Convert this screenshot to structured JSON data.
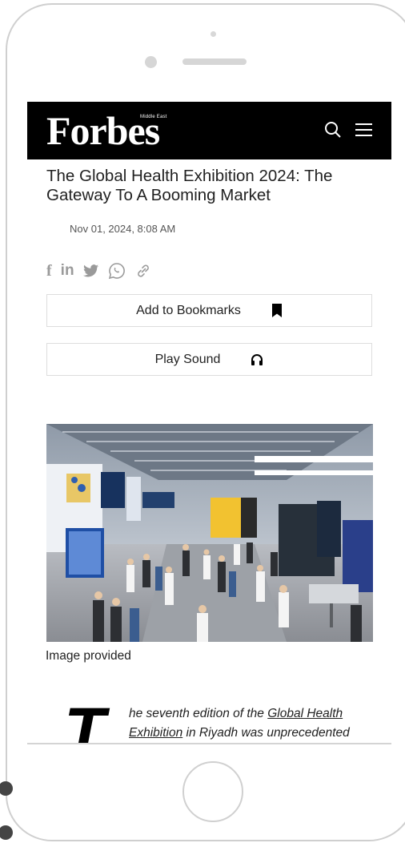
{
  "header": {
    "logo_text": "Forbes",
    "logo_sub": "Middle East",
    "search_icon": "search-icon",
    "menu_icon": "hamburger-menu-icon"
  },
  "article": {
    "title": "The Global Health Exhibition 2024: The Gateway To A Booming Market",
    "date": "Nov 01, 2024, 8:08 AM",
    "share_icons": [
      "facebook-icon",
      "linkedin-icon",
      "twitter-icon",
      "whatsapp-icon",
      "link-icon"
    ],
    "bookmark_label": "Add to Bookmarks",
    "play_label": "Play Sound",
    "image_caption": "Image provided",
    "drop_cap": "T",
    "body_prefix": "he seventh edition of the ",
    "body_link": "Global Health Exhibition",
    "body_suffix": " in Riyadh was unprecedented"
  },
  "colors": {
    "header_bg": "#000000",
    "icon_gray": "#9a9a9a"
  }
}
